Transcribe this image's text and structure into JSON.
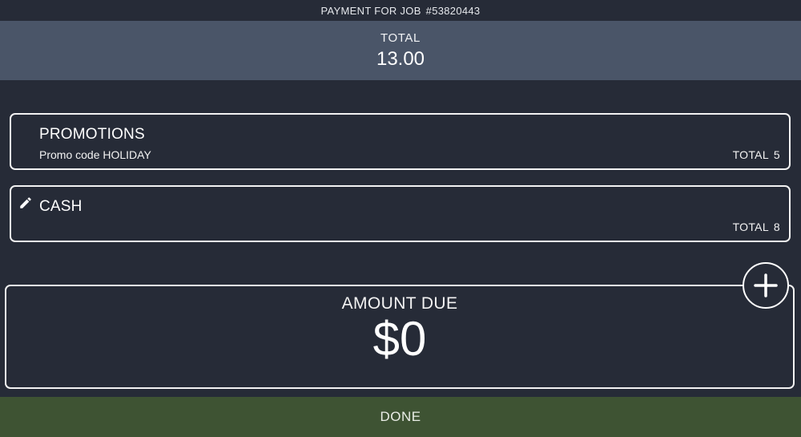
{
  "header": {
    "title": "PAYMENT FOR JOB",
    "job_number": "#53820443"
  },
  "total": {
    "label": "TOTAL",
    "value": "13.00"
  },
  "payments": [
    {
      "title": "PROMOTIONS",
      "subtitle": "Promo code HOLIDAY",
      "total_label": "TOTAL",
      "total_value": "5"
    },
    {
      "title": "CASH",
      "subtitle": "",
      "total_label": "TOTAL",
      "total_value": "8",
      "icon": "pencil-icon"
    }
  ],
  "amount_due": {
    "label": "AMOUNT DUE",
    "value": "$0"
  },
  "add_button": {
    "icon": "plus-icon"
  },
  "footer": {
    "done_label": "DONE"
  },
  "colors": {
    "background": "#262b37",
    "total_band": "#4a5568",
    "done_bar": "#3e5333",
    "border": "#f2f2f2"
  }
}
